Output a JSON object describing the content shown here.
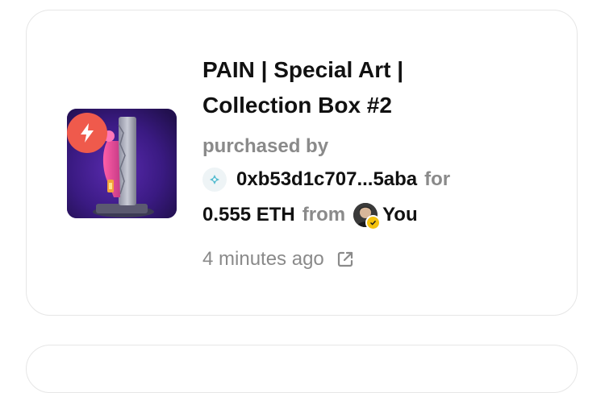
{
  "activity": {
    "title": "PAIN | Special Art | Collection Box #2",
    "title_line1": "PAIN | Special Art |",
    "title_line2": "Collection Box #2",
    "action_label": "purchased by",
    "buyer_address": "0xb53d1c707...5aba",
    "for_label": "for",
    "price": "0.555 ETH",
    "from_label": "from",
    "seller_name": "You",
    "timestamp": "4 minutes ago",
    "icons": {
      "badge": "lightning-bolt-icon",
      "chain": "chain-logo-icon",
      "verified": "verified-check-icon",
      "external": "external-link-icon"
    },
    "colors": {
      "badge": "#ef5a4c",
      "muted_text": "#8a8a8a",
      "primary_text": "#111111",
      "verified": "#f4c20d",
      "card_border": "#e6e6e6"
    }
  }
}
